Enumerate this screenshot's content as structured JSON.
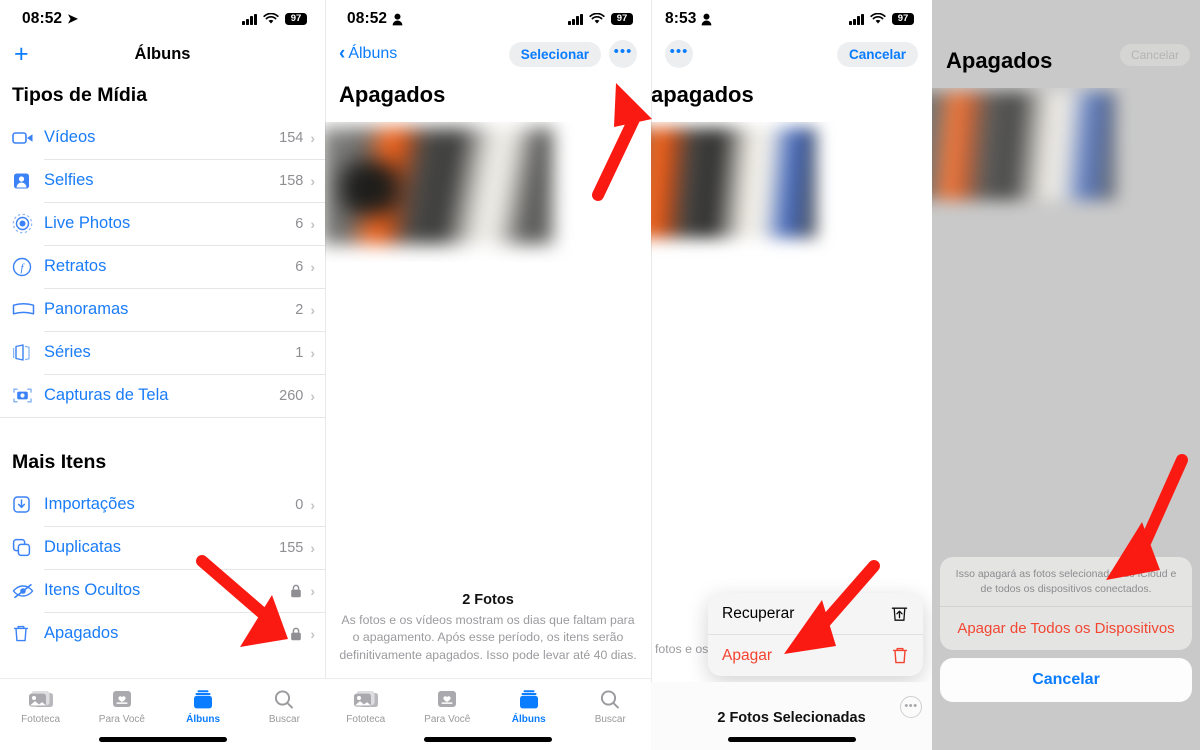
{
  "panel1": {
    "status": {
      "time": "08:52",
      "location_icon": "location-arrow-icon",
      "battery": "97"
    },
    "nav": {
      "add_label": "+",
      "title": "Álbuns"
    },
    "sections": [
      {
        "title": "Tipos de Mídia",
        "items": [
          {
            "icon": "video-icon",
            "label": "Vídeos",
            "count": "154"
          },
          {
            "icon": "selfie-icon",
            "label": "Selfies",
            "count": "158"
          },
          {
            "icon": "live-photo-icon",
            "label": "Live Photos",
            "count": "6"
          },
          {
            "icon": "portrait-icon",
            "label": "Retratos",
            "count": "6"
          },
          {
            "icon": "panorama-icon",
            "label": "Panoramas",
            "count": "2"
          },
          {
            "icon": "burst-icon",
            "label": "Séries",
            "count": "1"
          },
          {
            "icon": "screenshot-icon",
            "label": "Capturas de Tela",
            "count": "260"
          }
        ]
      },
      {
        "title": "Mais Itens",
        "items": [
          {
            "icon": "import-icon",
            "label": "Importações",
            "count": "0"
          },
          {
            "icon": "duplicate-icon",
            "label": "Duplicatas",
            "count": "155"
          },
          {
            "icon": "hidden-icon",
            "label": "Itens Ocultos",
            "count": "",
            "locked": true
          },
          {
            "icon": "trash-icon",
            "label": "Apagados",
            "count": "",
            "locked": true
          }
        ]
      }
    ],
    "tabs": [
      {
        "label": "Fototeca",
        "icon": "photos-icon",
        "active": false
      },
      {
        "label": "Para Você",
        "icon": "foryou-icon",
        "active": false
      },
      {
        "label": "Álbuns",
        "icon": "albums-icon",
        "active": true
      },
      {
        "label": "Buscar",
        "icon": "search-icon",
        "active": false
      }
    ]
  },
  "panel2": {
    "status": {
      "time": "08:52",
      "person_icon": "person-icon",
      "battery": "97"
    },
    "nav": {
      "back_label": "Álbuns",
      "select_label": "Selecionar",
      "more_label": "•••"
    },
    "title": "Apagados",
    "footer": {
      "count": "2 Fotos",
      "description": "As fotos e os vídeos mostram os dias que faltam para o apagamento. Após esse período, os itens serão definitivamente apagados. Isso pode levar até 40 dias."
    },
    "tabs": [
      {
        "label": "Fototeca",
        "active": false
      },
      {
        "label": "Para Você",
        "active": false
      },
      {
        "label": "Álbuns",
        "active": true
      },
      {
        "label": "Buscar",
        "active": false
      }
    ]
  },
  "panel3": {
    "status": {
      "time": "8:53",
      "person_icon": "person-icon",
      "battery": "97"
    },
    "nav": {
      "more_label": "•••",
      "cancel_label": "Cancelar"
    },
    "title": "apagados",
    "footer": {
      "count": "",
      "description": "fotos e os víde apagame finitivamente a"
    },
    "context_menu": [
      {
        "label": "Recuperar",
        "icon": "restore-icon",
        "danger": false
      },
      {
        "label": "Apagar",
        "icon": "trash-icon",
        "danger": true
      }
    ],
    "bottom_bar": {
      "selected_label": "2 Fotos Selecionadas",
      "more_label": "•••"
    }
  },
  "panel4": {
    "cancel_pill": "Cancelar",
    "title": "Apagados",
    "sheet": {
      "message": "Isso apagará as fotos selecionadas do iCloud e de todos os dispositivos conectados.",
      "destructive_label": "Apagar de Todos os Dispositivos",
      "cancel_label": "Cancelar"
    }
  },
  "annotations": {
    "accent_blue": "#0a7cff",
    "destructive_red": "#f4432e",
    "arrow_color": "#fb1a12",
    "arrows": [
      {
        "name": "arrow-to-apagados-row"
      },
      {
        "name": "arrow-to-more-button"
      },
      {
        "name": "arrow-to-apagar-menu-item"
      },
      {
        "name": "arrow-to-apagar-todos-dispositivos"
      }
    ]
  }
}
